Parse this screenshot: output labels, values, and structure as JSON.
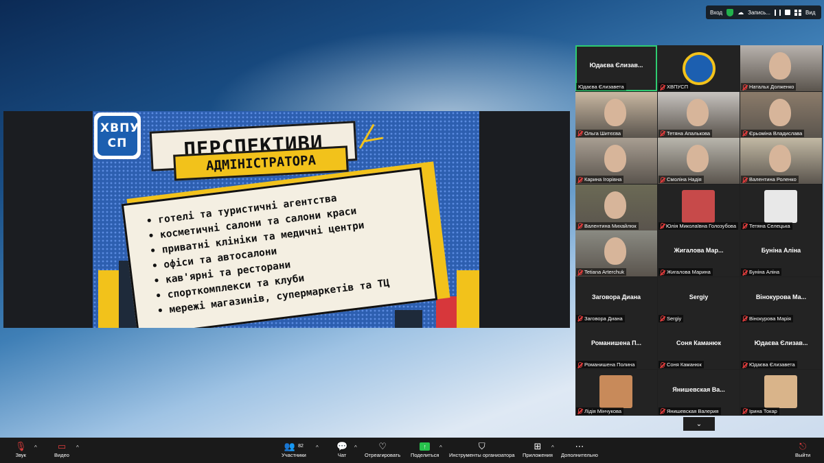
{
  "topbar": {
    "login_label": "Вход",
    "recording_label": "Запись...",
    "view_label": "Вид"
  },
  "slide": {
    "logo_text": "ХВПУ СП",
    "title": "ПЕРСПЕКТИВИ",
    "subtitle": "АДМІНІСТРАТОРА",
    "items": [
      "готелі та туристичні агентства",
      "косметичні салони та салони краси",
      "приватні клініки та медичні центри",
      "офіси та автосалони",
      "кав'ярні та ресторани",
      "спорткомплекси та клуби",
      "мережі магазинів, супермаркетів та ТЦ"
    ]
  },
  "participants": [
    {
      "label": "Юдаєва Єлизавета",
      "bigname": "Юдаєва Єлизав...",
      "kind": "name",
      "active": true
    },
    {
      "label": "ХВПУСП",
      "bigname": "",
      "kind": "logo"
    },
    {
      "label": "Натальх Долженко",
      "bigname": "",
      "kind": "video",
      "color": "#b8b2ad"
    },
    {
      "label": "Ольга Шитєєва",
      "bigname": "",
      "kind": "video",
      "color": "#c9b8a2"
    },
    {
      "label": "Тетяна Апалькова",
      "bigname": "",
      "kind": "video",
      "color": "#c7c3bf"
    },
    {
      "label": "Єрьоміна Владислава",
      "bigname": "",
      "kind": "video",
      "color": "#8b7b6a"
    },
    {
      "label": "Карина Ігорівна",
      "bigname": "",
      "kind": "video",
      "color": "#a89e92"
    },
    {
      "label": "Смоліна Надія",
      "bigname": "",
      "kind": "video",
      "color": "#b9b6ad"
    },
    {
      "label": "Валентина Роленко",
      "bigname": "",
      "kind": "video",
      "color": "#c2b9a4"
    },
    {
      "label": "Валентина Михайлюк",
      "bigname": "",
      "kind": "video",
      "color": "#6b6a55"
    },
    {
      "label": "Юлія Миколаївна Голозубова",
      "bigname": "",
      "kind": "thumb",
      "color": "#c74a4a"
    },
    {
      "label": "Тетяна Селецька",
      "bigname": "",
      "kind": "thumb",
      "color": "#e8e8e8"
    },
    {
      "label": "Tetiana Arterchuk",
      "bigname": "",
      "kind": "video",
      "color": "#8a8a82"
    },
    {
      "label": "Жигалова Марина",
      "bigname": "Жигалова  Мар...",
      "kind": "name"
    },
    {
      "label": "Буніна Аліна",
      "bigname": "Буніна Аліна",
      "kind": "name"
    },
    {
      "label": "Заговора Диана",
      "bigname": "Заговора Диана",
      "kind": "name"
    },
    {
      "label": "Sergiy",
      "bigname": "Sergiy",
      "kind": "name"
    },
    {
      "label": "Вінокурова Марія",
      "bigname": "Вінокурова  Ма...",
      "kind": "name"
    },
    {
      "label": "Романишена Полина",
      "bigname": "Романишена  П...",
      "kind": "name"
    },
    {
      "label": "Соня Каманюк",
      "bigname": "Соня Каманюк",
      "kind": "name"
    },
    {
      "label": "Юдаєва Єлизавета",
      "bigname": "Юдаєва  Єлизав...",
      "kind": "name"
    },
    {
      "label": "Лідія Мінчукова",
      "bigname": "",
      "kind": "thumb",
      "color": "#c88a5a"
    },
    {
      "label": "Янишевская Валерия",
      "bigname": "Янишевская  Ва...",
      "kind": "name"
    },
    {
      "label": "Ірина Токар",
      "bigname": "",
      "kind": "thumb",
      "color": "#d9b48a"
    }
  ],
  "toolbar": {
    "audio": "Звук",
    "video": "Видео",
    "participants": "Участники",
    "participants_count": "82",
    "chat": "Чат",
    "react": "Отреагировать",
    "share": "Поделиться",
    "host_tools": "Инструменты организатора",
    "apps": "Приложения",
    "more": "Дополнительно",
    "leave": "Выйти"
  }
}
